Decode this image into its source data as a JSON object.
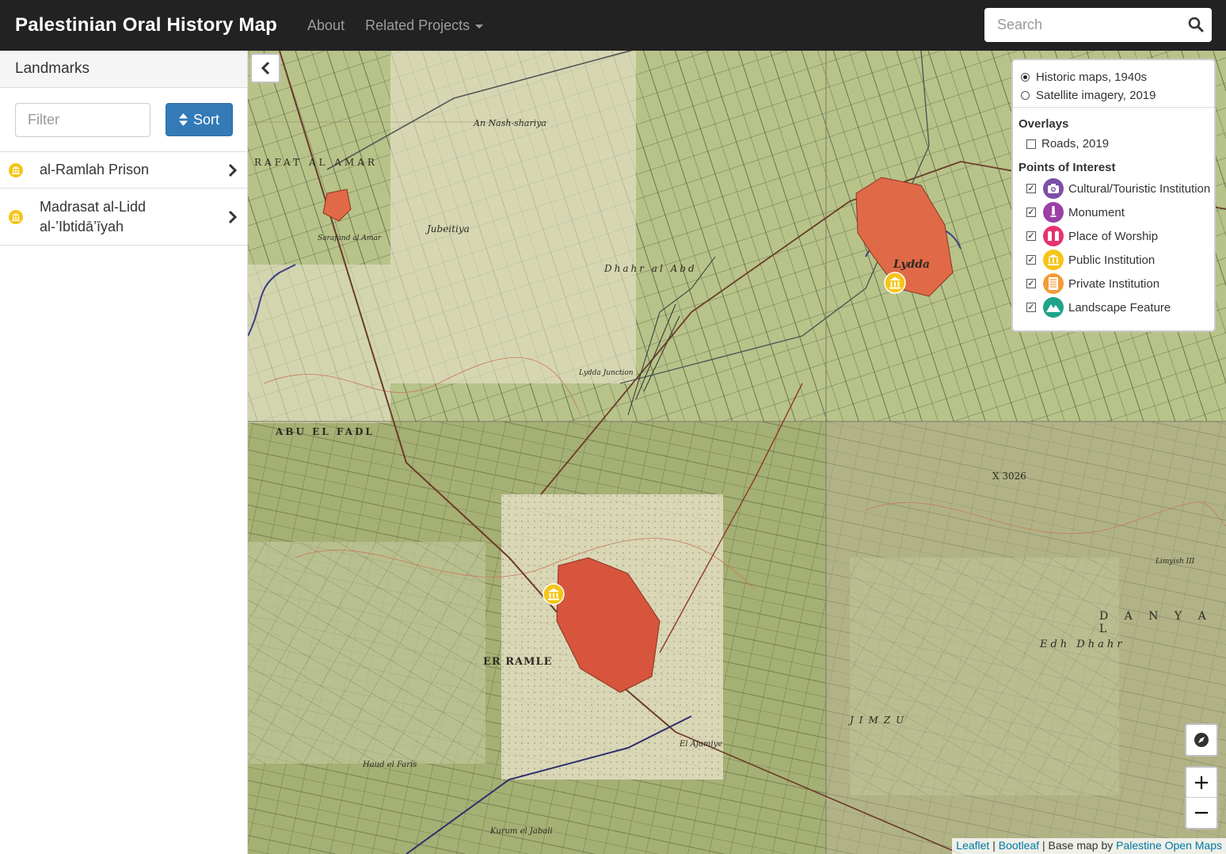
{
  "navbar": {
    "brand": "Palestinian Oral History Map",
    "links": [
      "About",
      "Related Projects"
    ],
    "search_placeholder": "Search"
  },
  "sidebar": {
    "title": "Landmarks",
    "filter_placeholder": "Filter",
    "sort_label": "Sort",
    "items": [
      {
        "lines": [
          "al-Ramlah Prison"
        ],
        "category": "Public Institution"
      },
      {
        "lines": [
          "Madrasat al-Lidd",
          "al-’Ibtidā’īyah"
        ],
        "category": "Public Institution"
      }
    ]
  },
  "map": {
    "base_layers": [
      {
        "label": "Historic maps, 1940s",
        "selected": true
      },
      {
        "label": "Satellite imagery, 2019",
        "selected": false
      }
    ],
    "overlays_title": "Overlays",
    "overlays": [
      {
        "label": "Roads, 2019",
        "checked": false
      }
    ],
    "poi_title": "Points of Interest",
    "poi": [
      {
        "label": "Cultural/Touristic Institution",
        "checked": true,
        "color": "#7b4fa8",
        "icon": "camera-icon"
      },
      {
        "label": "Monument",
        "checked": true,
        "color": "#9b3fa6",
        "icon": "monument-icon"
      },
      {
        "label": "Place of Worship",
        "checked": true,
        "color": "#e8336d",
        "icon": "worship-icon"
      },
      {
        "label": "Public Institution",
        "checked": true,
        "color": "#f5c518",
        "icon": "building-icon"
      },
      {
        "label": "Private Institution",
        "checked": true,
        "color": "#f39c34",
        "icon": "office-icon"
      },
      {
        "label": "Landscape Feature",
        "checked": true,
        "color": "#1fa38a",
        "icon": "mountain-icon"
      }
    ],
    "zoom_in": "+",
    "zoom_out": "−",
    "place_labels": [
      "Lydda",
      "ER RAMLE",
      "An Nash-shariya",
      "Jubeitiya",
      "RAFAT AL AMAR",
      "ABU EL FADL",
      "Sarafand al Amar",
      "Dhahr al Abd",
      "Lydda Junction",
      "Edh Dhahr",
      "Haud el Faris",
      "Kurum el Jabali",
      "El Ajamiye",
      "JIMZU",
      "D A N Y A L",
      "Limyish III",
      "X 3026"
    ],
    "attribution": {
      "leaflet": "Leaflet",
      "sep1": " | ",
      "bootleaf": "Bootleaf",
      "middle": " | Base map by ",
      "source": "Palestine Open Maps"
    }
  }
}
